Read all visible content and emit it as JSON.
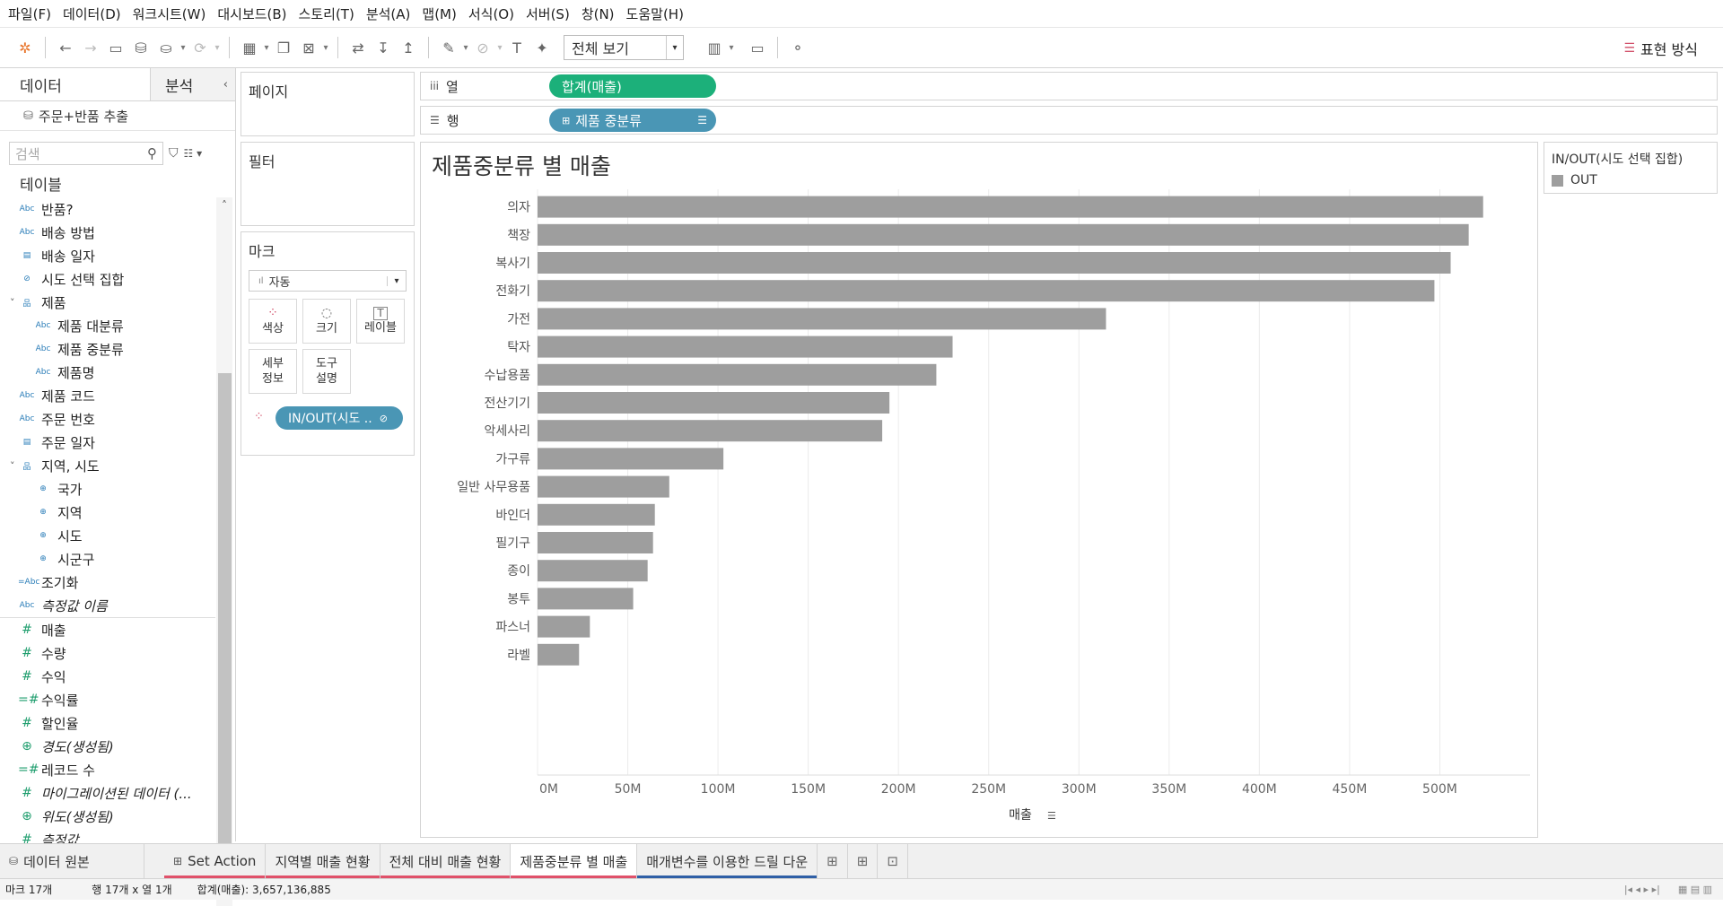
{
  "menu": [
    "파일(F)",
    "데이터(D)",
    "워크시트(W)",
    "대시보드(B)",
    "스토리(T)",
    "분석(A)",
    "맵(M)",
    "서식(O)",
    "서버(S)",
    "창(N)",
    "도움말(H)"
  ],
  "toolbar": {
    "view_select": "전체 보기",
    "show_me": "표현 방식"
  },
  "left_pane": {
    "tab_data": "데이터",
    "tab_analysis": "분석",
    "data_source": "주문+반품 추출",
    "search_placeholder": "검색",
    "tables_heading": "테이블",
    "fields": [
      {
        "label": "반품?",
        "type": "Abc",
        "indent": 0,
        "italic": false,
        "measure": false
      },
      {
        "label": "배송 방법",
        "type": "Abc",
        "indent": 0,
        "italic": false,
        "measure": false
      },
      {
        "label": "배송 일자",
        "type": "cal",
        "indent": 0,
        "italic": false,
        "measure": false
      },
      {
        "label": "시도 선택 집합",
        "type": "set",
        "indent": 0,
        "italic": false,
        "measure": false
      },
      {
        "label": "제품",
        "type": "hier",
        "indent": 0,
        "italic": false,
        "measure": false
      },
      {
        "label": "제품 대분류",
        "type": "Abc",
        "indent": 1,
        "italic": false,
        "measure": false
      },
      {
        "label": "제품 중분류",
        "type": "Abc",
        "indent": 1,
        "italic": false,
        "measure": false
      },
      {
        "label": "제품명",
        "type": "Abc",
        "indent": 1,
        "italic": false,
        "measure": false
      },
      {
        "label": "제품 코드",
        "type": "Abc",
        "indent": 0,
        "italic": false,
        "measure": false
      },
      {
        "label": "주문 번호",
        "type": "Abc",
        "indent": 0,
        "italic": false,
        "measure": false
      },
      {
        "label": "주문 일자",
        "type": "cal",
        "indent": 0,
        "italic": false,
        "measure": false
      },
      {
        "label": "지역, 시도",
        "type": "hier",
        "indent": 0,
        "italic": false,
        "measure": false
      },
      {
        "label": "국가",
        "type": "globe",
        "indent": 1,
        "italic": false,
        "measure": false
      },
      {
        "label": "지역",
        "type": "globe",
        "indent": 1,
        "italic": false,
        "measure": false
      },
      {
        "label": "시도",
        "type": "globe",
        "indent": 1,
        "italic": false,
        "measure": false
      },
      {
        "label": "시군구",
        "type": "globe",
        "indent": 1,
        "italic": false,
        "measure": false
      },
      {
        "label": "조기화",
        "type": "=Abc",
        "indent": 0,
        "italic": false,
        "measure": false
      },
      {
        "label": "측정값 이름",
        "type": "Abc",
        "indent": 0,
        "italic": true,
        "measure": false
      },
      {
        "label": "매출",
        "type": "#",
        "indent": 0,
        "italic": false,
        "measure": true
      },
      {
        "label": "수량",
        "type": "#",
        "indent": 0,
        "italic": false,
        "measure": true
      },
      {
        "label": "수익",
        "type": "#",
        "indent": 0,
        "italic": false,
        "measure": true
      },
      {
        "label": "수익률",
        "type": "=#",
        "indent": 0,
        "italic": false,
        "measure": true
      },
      {
        "label": "할인율",
        "type": "#",
        "indent": 0,
        "italic": false,
        "measure": true
      },
      {
        "label": "경도(생성됨)",
        "type": "globe",
        "indent": 0,
        "italic": true,
        "measure": true
      },
      {
        "label": "레코드 수",
        "type": "=#",
        "indent": 0,
        "italic": false,
        "measure": true
      },
      {
        "label": "마이그레이션된 데이터 (...",
        "type": "#",
        "indent": 0,
        "italic": true,
        "measure": true
      },
      {
        "label": "위도(생성됨)",
        "type": "globe",
        "indent": 0,
        "italic": true,
        "measure": true
      },
      {
        "label": "측정값",
        "type": "#",
        "indent": 0,
        "italic": true,
        "measure": true
      }
    ]
  },
  "pages_card": {
    "title": "페이지"
  },
  "filters_card": {
    "title": "필터"
  },
  "marks_card": {
    "title": "마크",
    "mark_type": "자동",
    "buttons": {
      "color": "색상",
      "size": "크기",
      "label": "레이블",
      "detail_1": "세부",
      "detail_2": "정보",
      "tooltip_1": "도구",
      "tooltip_2": "설명"
    },
    "pill": "IN/OUT(시도 .."
  },
  "shelves": {
    "columns_label": "열",
    "columns_pill": "합계(매출)",
    "rows_label": "행",
    "rows_pill": "제품 중분류"
  },
  "legend": {
    "title": "IN/OUT(시도 선택 집합)",
    "item": "OUT",
    "item_color": "#9e9e9e"
  },
  "colors": {
    "bar": "#9e9e9e",
    "measure_pill": "#1cb07a",
    "dimension_pill": "#4a96b5",
    "set_pill": "#4a96b5"
  },
  "chart_data": {
    "type": "bar",
    "orientation": "horizontal",
    "title": "제품중분류 별 매출",
    "xlabel": "매출",
    "ylabel": "",
    "xlim": [
      0,
      550000000
    ],
    "x_ticks": [
      "0M",
      "50M",
      "100M",
      "150M",
      "200M",
      "250M",
      "300M",
      "350M",
      "400M",
      "450M",
      "500M"
    ],
    "categories": [
      "의자",
      "책장",
      "복사기",
      "전화기",
      "가전",
      "탁자",
      "수납용품",
      "전산기기",
      "악세사리",
      "가구류",
      "일반 사무용품",
      "바인더",
      "필기구",
      "종이",
      "봉투",
      "파스너",
      "라벨"
    ],
    "values": [
      524000000,
      516000000,
      506000000,
      497000000,
      315000000,
      230000000,
      221000000,
      195000000,
      191000000,
      103000000,
      73000000,
      65000000,
      64000000,
      61000000,
      53000000,
      29000000,
      23000000
    ]
  },
  "sheet_tabs": [
    {
      "label": "데이터 원본",
      "icon": "db",
      "underline": "",
      "active": false
    },
    {
      "label": "Set Action",
      "icon": "grid",
      "underline": "#e0516a",
      "active": false
    },
    {
      "label": "지역별 매출 현황",
      "icon": "",
      "underline": "#e0516a",
      "active": false
    },
    {
      "label": "전체 대비 매출 현황",
      "icon": "",
      "underline": "#e0516a",
      "active": false
    },
    {
      "label": "제품중분류 별 매출",
      "icon": "",
      "underline": "#e0516a",
      "active": true
    },
    {
      "label": "매개변수를 이용한 드릴 다운",
      "icon": "",
      "underline": "#2f5fa6",
      "active": false
    }
  ],
  "status": {
    "marks": "마크 17개",
    "rows_cols": "행 17개 x 열 1개",
    "sum": "합계(매출): 3,657,136,885"
  }
}
